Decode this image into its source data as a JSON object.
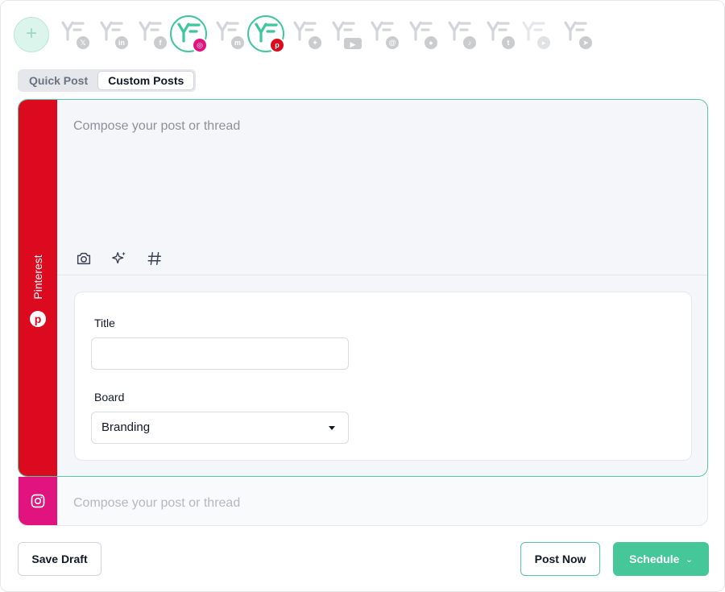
{
  "accounts": {
    "add_label": "+",
    "items": [
      {
        "network": "x",
        "badge": "𝕏"
      },
      {
        "network": "linkedin",
        "badge": "in"
      },
      {
        "network": "facebook",
        "badge": "f"
      },
      {
        "network": "instagram",
        "badge": "◎"
      },
      {
        "network": "mastodon",
        "badge": "m"
      },
      {
        "network": "pinterest",
        "badge": "p"
      },
      {
        "network": "bluesky",
        "badge": "✦"
      },
      {
        "network": "youtube",
        "badge": "▶"
      },
      {
        "network": "threads",
        "badge": "@"
      },
      {
        "network": "patreon",
        "badge": "●"
      },
      {
        "network": "tiktok",
        "badge": "♪"
      },
      {
        "network": "tumblr",
        "badge": "t"
      },
      {
        "network": "google",
        "badge": "▸"
      },
      {
        "network": "telegram",
        "badge": "➤"
      }
    ]
  },
  "tabs": {
    "quick": "Quick Post",
    "custom": "Custom Posts"
  },
  "pinterest": {
    "side_label": "Pinterest",
    "compose_placeholder": "Compose your post or thread",
    "title_label": "Title",
    "title_value": "",
    "board_label": "Board",
    "board_value": "Branding"
  },
  "instagram": {
    "compose_placeholder": "Compose your post or thread"
  },
  "footer": {
    "save_draft": "Save Draft",
    "post_now": "Post Now",
    "schedule": "Schedule"
  },
  "colors": {
    "brand_green": "#45c79a",
    "pinterest_red": "#dc0a1e",
    "instagram_pink": "#e1137f"
  }
}
